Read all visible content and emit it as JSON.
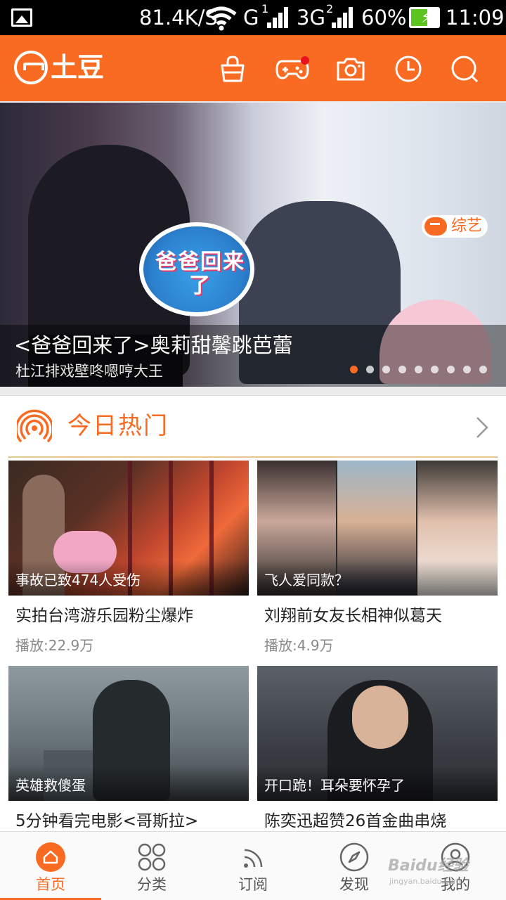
{
  "status_bar": {
    "speed": "81.4K/S",
    "network1": "G",
    "sim1": "1",
    "network2": "3G",
    "sim2": "2",
    "battery": "60%",
    "battery_level": 0.6,
    "time": "11:09"
  },
  "header": {
    "logo_text": "土豆",
    "icons": [
      "shopping-bag-icon",
      "gamepad-icon",
      "camera-icon",
      "clock-icon",
      "search-icon"
    ],
    "accent_color": "#f96b22"
  },
  "banner": {
    "show_logo_text": "爸爸回来了",
    "tag": "综艺",
    "title": "<爸爸回来了>奥莉甜馨跳芭蕾",
    "subtitle": "杜江排戏壁咚嗯哼大王",
    "slide_count": 9,
    "active_slide": 1
  },
  "hot": {
    "title": "今日热门",
    "items": [
      {
        "caption": "事故已致474人受伤",
        "title": "实拍台湾游乐园粉尘爆炸",
        "plays": "播放:22.9万"
      },
      {
        "caption": "飞人爱同款？",
        "title": "刘翔前女友长相神似葛天",
        "plays": "播放:4.9万"
      },
      {
        "caption": "英雄救傻蛋",
        "title": "5分钟看完电影<哥斯拉>",
        "plays": ""
      },
      {
        "caption": "开口跪！耳朵要怀孕了",
        "title": "陈奕迅超赞26首金曲串烧",
        "plays": ""
      }
    ]
  },
  "bottom_nav": {
    "items": [
      {
        "label": "首页",
        "icon": "home-icon"
      },
      {
        "label": "分类",
        "icon": "grid-icon"
      },
      {
        "label": "订阅",
        "icon": "rss-icon"
      },
      {
        "label": "发现",
        "icon": "compass-icon"
      },
      {
        "label": "我的",
        "icon": "user-icon"
      }
    ],
    "active": 0
  },
  "watermark": {
    "text": "Baidu经验",
    "sub": "jingyan.baidu.com"
  }
}
